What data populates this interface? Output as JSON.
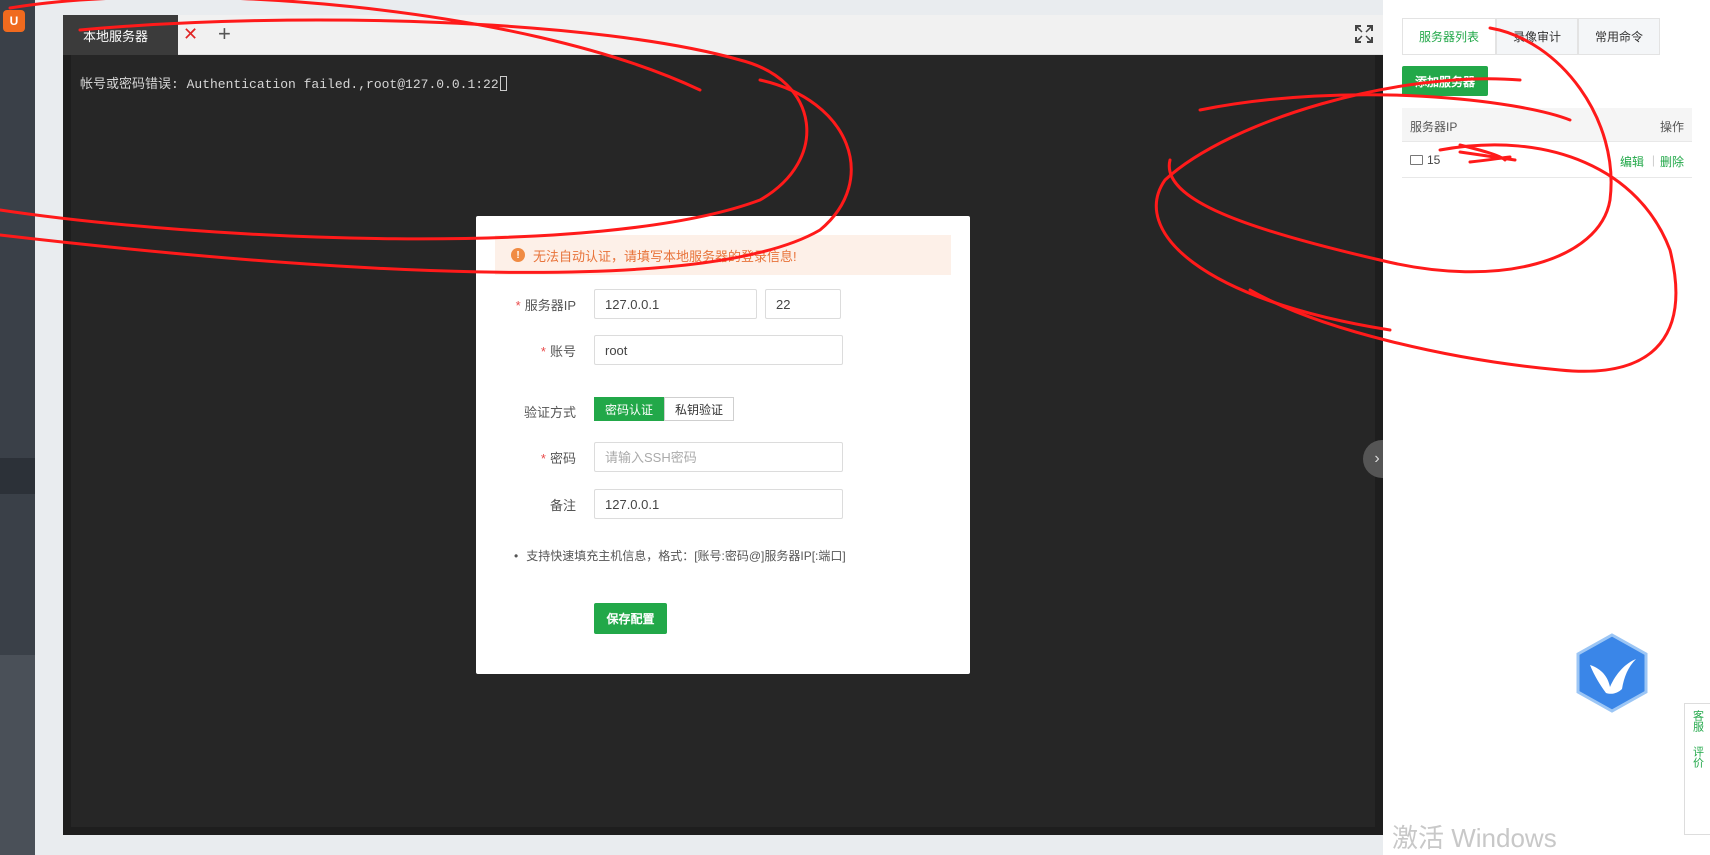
{
  "app": {
    "logo_letter": "U"
  },
  "tabs": {
    "active_label": "本地服务器",
    "close_glyph": "✕",
    "add_glyph": "+"
  },
  "terminal": {
    "output_line": "帐号或密码错误: Authentication failed.,root@127.0.0.1:22"
  },
  "dialog": {
    "alert_text": "无法自动认证，请填写本地服务器的登录信息!",
    "fields": {
      "server_ip_label": "服务器IP",
      "server_ip_value": "127.0.0.1",
      "port_value": "22",
      "account_label": "账号",
      "account_value": "root",
      "auth_label": "验证方式",
      "auth_options": [
        "密码认证",
        "私钥验证"
      ],
      "auth_selected": "密码认证",
      "password_label": "密码",
      "password_placeholder": "请输入SSH密码",
      "remark_label": "备注",
      "remark_value": "127.0.0.1"
    },
    "hint": "支持快速填充主机信息，格式：[账号:密码@]服务器IP[:端口]",
    "save_button": "保存配置"
  },
  "right_panel": {
    "tabs": [
      "服务器列表",
      "录像审计",
      "常用命令"
    ],
    "active_tab": "服务器列表",
    "add_button": "添加服务器",
    "table": {
      "col_ip": "服务器IP",
      "col_actions": "操作",
      "rows": [
        {
          "ip": "15",
          "edit": "编辑",
          "delete": "删除"
        }
      ]
    }
  },
  "side_feedback": {
    "service": "客服",
    "review": "评价"
  },
  "watermark": "激活 Windows",
  "colors": {
    "accent": "#22a849",
    "terminal_bg": "#262626",
    "warning": "#e8733a",
    "annotation": "#ff1a1a"
  }
}
